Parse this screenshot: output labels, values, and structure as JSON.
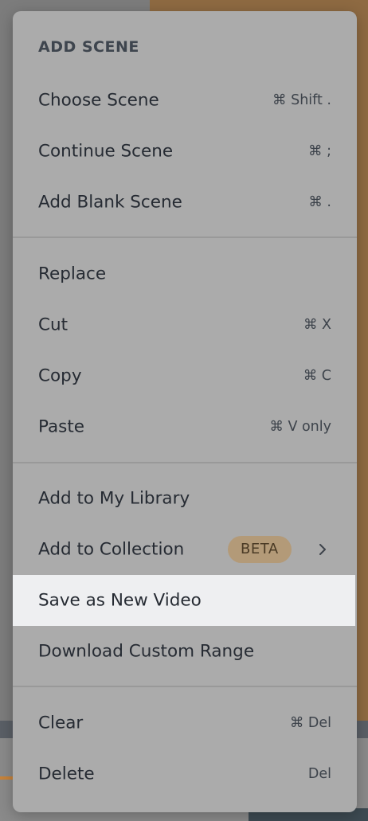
{
  "menu": {
    "section_header": "ADD SCENE",
    "groups": [
      {
        "items": [
          {
            "label": "Choose Scene",
            "shortcut": "⌘ Shift ."
          },
          {
            "label": "Continue Scene",
            "shortcut": "⌘ ;"
          },
          {
            "label": "Add Blank Scene",
            "shortcut": "⌘ ."
          }
        ]
      },
      {
        "items": [
          {
            "label": "Replace",
            "shortcut": ""
          },
          {
            "label": "Cut",
            "shortcut": "⌘ X"
          },
          {
            "label": "Copy",
            "shortcut": "⌘ C"
          },
          {
            "label": "Paste",
            "shortcut": "⌘ V only"
          }
        ]
      },
      {
        "items": [
          {
            "label": "Add to My Library",
            "shortcut": ""
          },
          {
            "label": "Add to Collection",
            "badge": "BETA",
            "has_submenu": true,
            "submenu_icon": "chevron-right-icon"
          },
          {
            "label": "Save as New Video",
            "highlighted": true
          },
          {
            "label": "Download Custom Range",
            "shortcut": ""
          }
        ]
      },
      {
        "items": [
          {
            "label": "Clear",
            "shortcut": "⌘ Del"
          },
          {
            "label": "Delete",
            "shortcut": "Del"
          }
        ]
      }
    ]
  },
  "colors": {
    "menu_background": "#ababab",
    "highlight_background": "#eeeff1",
    "badge_background": "#b39a78",
    "text": "#262b33"
  }
}
